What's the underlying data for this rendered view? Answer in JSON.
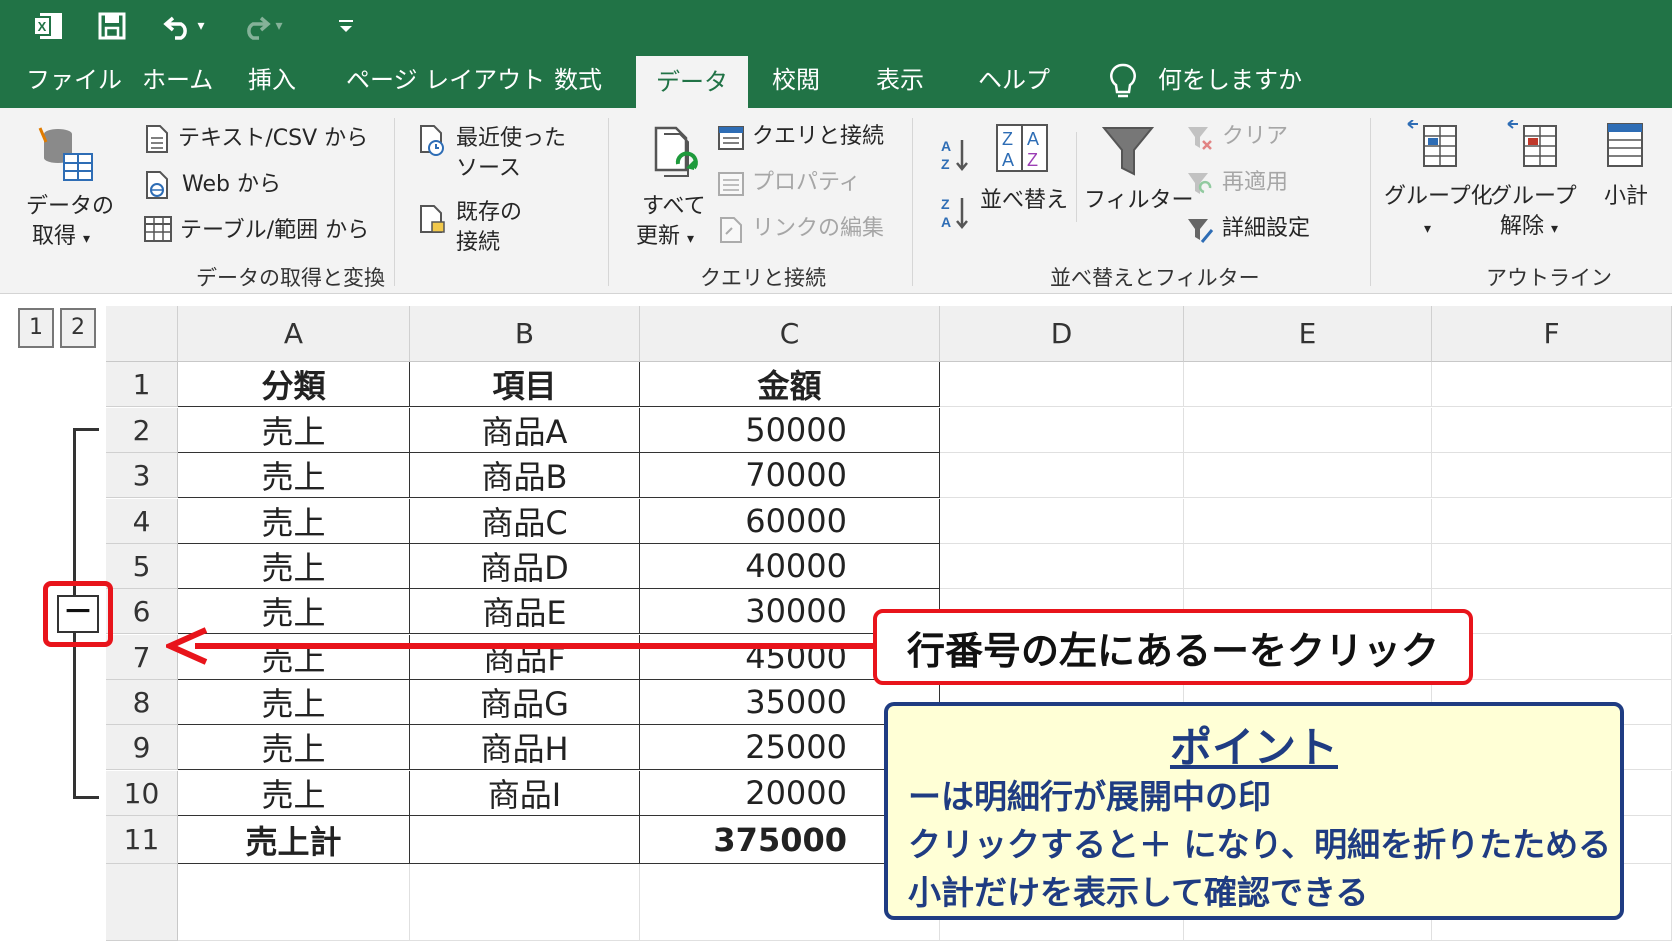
{
  "colors": {
    "title_bar": "#217346",
    "callout_border": "#e8141b",
    "point_border": "#1f3c82",
    "point_bg": "#ffffd6"
  },
  "quick_access": {
    "icons": [
      "excel-logo-icon",
      "save-icon",
      "undo-icon",
      "redo-icon",
      "customize-icon"
    ]
  },
  "tabs": [
    "ファイル",
    "ホーム",
    "挿入",
    "ページ レイアウト",
    "数式",
    "データ",
    "校閲",
    "表示",
    "ヘルプ"
  ],
  "active_tab": "データ",
  "tell_me": "何をしますか",
  "ribbon": {
    "get_data": {
      "line1": "データの",
      "line2": "取得"
    },
    "from_text_csv": "テキスト/CSV から",
    "from_web": "Web から",
    "from_table": "テーブル/範囲 から",
    "recent_sources": {
      "line1": "最近使った",
      "line2": "ソース"
    },
    "existing_connections": {
      "line1": "既存の",
      "line2": "接続"
    },
    "group_get_transform": "データの取得と変換",
    "refresh_all": {
      "line1": "すべて",
      "line2": "更新"
    },
    "queries_connections": "クエリと接続",
    "properties": "プロパティ",
    "edit_links": "リンクの編集",
    "group_queries": "クエリと接続",
    "sort": "並べ替え",
    "filter": "フィルター",
    "clear": "クリア",
    "reapply": "再適用",
    "advanced": "詳細設定",
    "group_sort_filter": "並べ替えとフィルター",
    "group_btn": "グループ化",
    "ungroup": {
      "line1": "グループ",
      "line2": "解除"
    },
    "subtotal": "小計",
    "group_outline": "アウトライン"
  },
  "outline_levels": [
    "1",
    "2"
  ],
  "columns": [
    "A",
    "B",
    "C",
    "D",
    "E",
    "F"
  ],
  "rows": [
    {
      "num": "1",
      "a": "分類",
      "b": "項目",
      "c": "金額"
    },
    {
      "num": "2",
      "a": "売上",
      "b": "商品A",
      "c": "50000"
    },
    {
      "num": "3",
      "a": "売上",
      "b": "商品B",
      "c": "70000"
    },
    {
      "num": "4",
      "a": "売上",
      "b": "商品C",
      "c": "60000"
    },
    {
      "num": "5",
      "a": "売上",
      "b": "商品D",
      "c": "40000"
    },
    {
      "num": "6",
      "a": "売上",
      "b": "商品E",
      "c": "30000"
    },
    {
      "num": "7",
      "a": "売上",
      "b": "商品F",
      "c": "45000"
    },
    {
      "num": "8",
      "a": "売上",
      "b": "商品G",
      "c": "35000"
    },
    {
      "num": "9",
      "a": "売上",
      "b": "商品H",
      "c": "25000"
    },
    {
      "num": "10",
      "a": "売上",
      "b": "商品I",
      "c": "20000"
    },
    {
      "num": "11",
      "a": "売上計",
      "b": "",
      "c": "375000"
    }
  ],
  "collapse_button": "－",
  "callout": "行番号の左にあるーをクリック",
  "point": {
    "title": "ポイント",
    "line1": "ーは明細行が展開中の印",
    "line2": "クリックすると＋ になり、明細を折りたためる",
    "line3": "小計だけを表示して確認できる"
  }
}
